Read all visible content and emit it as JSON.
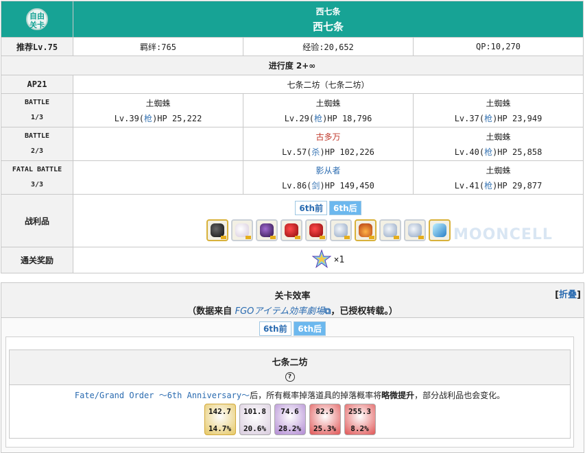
{
  "header": {
    "badge_line1": "自由",
    "badge_line2": "关卡",
    "title_small": "西七条",
    "title_large": "西七条"
  },
  "summary": {
    "rec_level": "推荐Lv.75",
    "bond": "羁绊:765",
    "exp": "经验:20,652",
    "qp": "QP:10,270"
  },
  "progress": "进行度 2+∞",
  "ap": {
    "label": "AP21",
    "location": "七条二坊（七条二坊）"
  },
  "battles": [
    {
      "label1": "BATTLE",
      "label2": "1/3",
      "enemies": [
        {
          "name": "土蜘蛛",
          "lv": "Lv.39(",
          "cls": "枪",
          "hp": ")HP 25,222"
        },
        {
          "name": "土蜘蛛",
          "lv": "Lv.29(",
          "cls": "枪",
          "hp": ")HP 18,796"
        },
        {
          "name": "土蜘蛛",
          "lv": "Lv.37(",
          "cls": "枪",
          "hp": ")HP 23,949"
        }
      ]
    },
    {
      "label1": "BATTLE",
      "label2": "2/3",
      "enemies": [
        {
          "name": "古多万",
          "lv": "Lv.57(",
          "cls": "杀",
          "hp": ")HP 102,226"
        },
        {
          "name": "土蜘蛛",
          "lv": "Lv.40(",
          "cls": "枪",
          "hp": ")HP 25,858"
        }
      ]
    },
    {
      "label1": "FATAL BATTLE",
      "label2": "3/3",
      "enemies": [
        {
          "name": "影从者",
          "lv": "Lv.86(",
          "cls": "剑",
          "hp": ")HP 149,450"
        },
        {
          "name": "土蜘蛛",
          "lv": "Lv.41(",
          "cls": "枪",
          "hp": ")HP 29,877"
        }
      ]
    }
  ],
  "drops": {
    "label": "战利品",
    "tabs": [
      "6th前",
      "6th后"
    ],
    "items": [
      "black-bone-icon",
      "white-orb-icon",
      "purple-gem-icon",
      "red-gem-icon",
      "red-gem-icon",
      "silver-monument-icon",
      "fire-piece-icon",
      "silver-monument-icon",
      "silver-monument-icon",
      "blue-crystal-icon"
    ]
  },
  "reward": {
    "label": "通关奖励",
    "count": "×1"
  },
  "watermark": "MOONCELL",
  "efficiency": {
    "title": "关卡效率",
    "fold": "折叠",
    "source_pre": "（数据来自 ",
    "source_link": "FGOアイテム効率劇場",
    "source_post": "，已授权转载。）",
    "tabs": [
      "6th前",
      "6th后"
    ],
    "quest_name": "七条二坊",
    "help": "?",
    "notice_link": "Fate/Grand Order ～6th Anniversary～",
    "notice_mid": "后，所有概率掉落道具的掉落概率将",
    "notice_bold": "略微提升",
    "notice_post": "，部分战利品也会变化。",
    "rates": [
      {
        "value": "142.7",
        "percent": "14.7%",
        "icon": "black-bone-icon"
      },
      {
        "value": "101.8",
        "percent": "20.6%",
        "icon": "white-orb-icon"
      },
      {
        "value": "74.6",
        "percent": "28.2%",
        "icon": "purple-gem-icon"
      },
      {
        "value": "82.9",
        "percent": "25.3%",
        "icon": "red-gem-icon"
      },
      {
        "value": "255.3",
        "percent": "8.2%",
        "icon": "red-gem-icon"
      }
    ]
  },
  "colors": {
    "teal": "#17a395",
    "assassin_name": "#c0392b",
    "saber_name": "#2a6bb0",
    "tab_active": "#6cb8ee"
  }
}
